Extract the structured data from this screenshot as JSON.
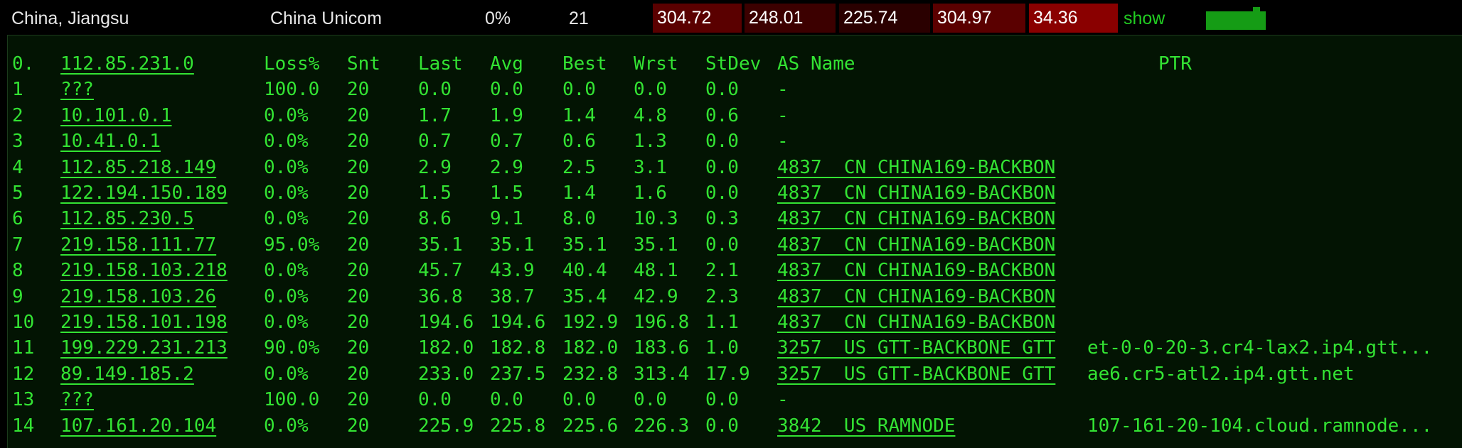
{
  "summary": {
    "location": "China, Jiangsu",
    "isp": "China Unicom",
    "loss": "0%",
    "sent": "21",
    "stats": [
      {
        "value": "304.72",
        "color": "#5a0000"
      },
      {
        "value": "248.01",
        "color": "#3c0000"
      },
      {
        "value": "225.74",
        "color": "#2a0000"
      },
      {
        "value": "304.97",
        "color": "#5a0000"
      },
      {
        "value": "34.36",
        "color": "#8a0000"
      }
    ],
    "show_label": "show",
    "signal_color": "#159c15"
  },
  "header": {
    "hop": "0.",
    "host": "112.85.231.0",
    "loss": "Loss%",
    "snt": "Snt",
    "last": "Last",
    "avg": "Avg",
    "best": "Best",
    "wrst": "Wrst",
    "stdev": "StDev",
    "as": "AS Name",
    "ptr": "PTR"
  },
  "hops": [
    {
      "hop": "1",
      "host": "???",
      "loss": "100.0",
      "snt": "20",
      "last": "0.0",
      "avg": "0.0",
      "best": "0.0",
      "wrst": "0.0",
      "stdev": "0.0",
      "as": "-",
      "ptr": ""
    },
    {
      "hop": "2",
      "host": "10.101.0.1",
      "loss": "0.0%",
      "snt": "20",
      "last": "1.7",
      "avg": "1.9",
      "best": "1.4",
      "wrst": "4.8",
      "stdev": "0.6",
      "as": "-",
      "ptr": ""
    },
    {
      "hop": "3",
      "host": "10.41.0.1",
      "loss": "0.0%",
      "snt": "20",
      "last": "0.7",
      "avg": "0.7",
      "best": "0.6",
      "wrst": "1.3",
      "stdev": "0.0",
      "as": "-",
      "ptr": ""
    },
    {
      "hop": "4",
      "host": "112.85.218.149",
      "loss": "0.0%",
      "snt": "20",
      "last": "2.9",
      "avg": "2.9",
      "best": "2.5",
      "wrst": "3.1",
      "stdev": "0.0",
      "as": "4837  CN CHINA169-BACKBON",
      "ptr": ""
    },
    {
      "hop": "5",
      "host": "122.194.150.189",
      "loss": "0.0%",
      "snt": "20",
      "last": "1.5",
      "avg": "1.5",
      "best": "1.4",
      "wrst": "1.6",
      "stdev": "0.0",
      "as": "4837  CN CHINA169-BACKBON",
      "ptr": ""
    },
    {
      "hop": "6",
      "host": "112.85.230.5",
      "loss": "0.0%",
      "snt": "20",
      "last": "8.6",
      "avg": "9.1",
      "best": "8.0",
      "wrst": "10.3",
      "stdev": "0.3",
      "as": "4837  CN CHINA169-BACKBON",
      "ptr": ""
    },
    {
      "hop": "7",
      "host": "219.158.111.77",
      "loss": "95.0%",
      "snt": "20",
      "last": "35.1",
      "avg": "35.1",
      "best": "35.1",
      "wrst": "35.1",
      "stdev": "0.0",
      "as": "4837  CN CHINA169-BACKBON",
      "ptr": ""
    },
    {
      "hop": "8",
      "host": "219.158.103.218",
      "loss": "0.0%",
      "snt": "20",
      "last": "45.7",
      "avg": "43.9",
      "best": "40.4",
      "wrst": "48.1",
      "stdev": "2.1",
      "as": "4837  CN CHINA169-BACKBON",
      "ptr": ""
    },
    {
      "hop": "9",
      "host": "219.158.103.26",
      "loss": "0.0%",
      "snt": "20",
      "last": "36.8",
      "avg": "38.7",
      "best": "35.4",
      "wrst": "42.9",
      "stdev": "2.3",
      "as": "4837  CN CHINA169-BACKBON",
      "ptr": ""
    },
    {
      "hop": "10",
      "host": "219.158.101.198",
      "loss": "0.0%",
      "snt": "20",
      "last": "194.6",
      "avg": "194.6",
      "best": "192.9",
      "wrst": "196.8",
      "stdev": "1.1",
      "as": "4837  CN CHINA169-BACKBON",
      "ptr": ""
    },
    {
      "hop": "11",
      "host": "199.229.231.213",
      "loss": "90.0%",
      "snt": "20",
      "last": "182.0",
      "avg": "182.8",
      "best": "182.0",
      "wrst": "183.6",
      "stdev": "1.0",
      "as": "3257  US GTT-BACKBONE GTT",
      "ptr": "et-0-0-20-3.cr4-lax2.ip4.gtt..."
    },
    {
      "hop": "12",
      "host": "89.149.185.2",
      "loss": "0.0%",
      "snt": "20",
      "last": "233.0",
      "avg": "237.5",
      "best": "232.8",
      "wrst": "313.4",
      "stdev": "17.9",
      "as": "3257  US GTT-BACKBONE GTT",
      "ptr": "ae6.cr5-atl2.ip4.gtt.net"
    },
    {
      "hop": "13",
      "host": "???",
      "loss": "100.0",
      "snt": "20",
      "last": "0.0",
      "avg": "0.0",
      "best": "0.0",
      "wrst": "0.0",
      "stdev": "0.0",
      "as": "-",
      "ptr": ""
    },
    {
      "hop": "14",
      "host": "107.161.20.104",
      "loss": "0.0%",
      "snt": "20",
      "last": "225.9",
      "avg": "225.8",
      "best": "225.6",
      "wrst": "226.3",
      "stdev": "0.0",
      "as": "3842  US RAMNODE",
      "ptr": "107-161-20-104.cloud.ramnode..."
    }
  ]
}
